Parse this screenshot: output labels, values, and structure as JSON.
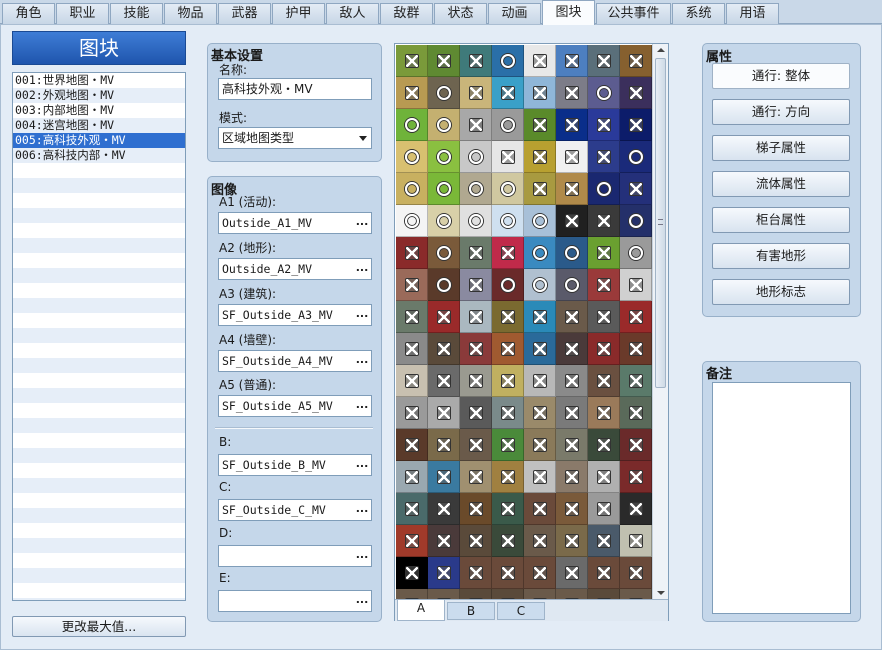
{
  "tabs": [
    "角色",
    "职业",
    "技能",
    "物品",
    "武器",
    "护甲",
    "敌人",
    "敌群",
    "状态",
    "动画",
    "图块",
    "公共事件",
    "系统",
    "用语"
  ],
  "active_tab_index": 10,
  "tileset_list": {
    "title": "图块",
    "items": [
      "001:世界地图・MV",
      "002:外观地图・MV",
      "003:内部地图・MV",
      "004:迷宫地图・MV",
      "005:高科技外观・MV",
      "006:高科技内部・MV"
    ],
    "selected_index": 4,
    "change_max_button": "更改最大值..."
  },
  "basic_settings": {
    "title": "基本设置",
    "name_label": "名称:",
    "name_value": "高科技外观・MV",
    "mode_label": "模式:",
    "mode_value": "区域地图类型"
  },
  "images": {
    "title": "图像",
    "fields": [
      {
        "label": "A1 (活动):",
        "value": "Outside_A1_MV"
      },
      {
        "label": "A2 (地形):",
        "value": "Outside_A2_MV"
      },
      {
        "label": "A3 (建筑):",
        "value": "SF_Outside_A3_MV"
      },
      {
        "label": "A4 (墙壁):",
        "value": "SF_Outside_A4_MV"
      },
      {
        "label": "A5 (普通):",
        "value": "SF_Outside_A5_MV"
      },
      {
        "label": "B:",
        "value": "SF_Outside_B_MV"
      },
      {
        "label": "C:",
        "value": "SF_Outside_C_MV"
      },
      {
        "label": "D:",
        "value": ""
      },
      {
        "label": "E:",
        "value": ""
      }
    ],
    "browse_glyph": "..."
  },
  "tile_palette": {
    "tabs": [
      "A",
      "B",
      "C"
    ],
    "active_tab": "A",
    "marks": "xxxoxxxxxoxxxxoxooxoxxxxoooxxxxoooooxxoxoooooxxoxoxxooxoxoxoooxxxxxxxxxxxxxxxxxxxxxxxxxxxxxxxxxxxxxxxxxxxxxxxxxxxxxxxxxxxxxxxxxxxxxxxxxxxxxxxxxxxxxxxxxxxxxxxxxxxxxxxoooooo"
  },
  "properties": {
    "title": "属性",
    "buttons": [
      "通行: 整体",
      "通行: 方向",
      "梯子属性",
      "流体属性",
      "柜台属性",
      "有害地形",
      "地形标志"
    ],
    "pressed_index": 0
  },
  "note": {
    "title": "备注",
    "value": ""
  }
}
